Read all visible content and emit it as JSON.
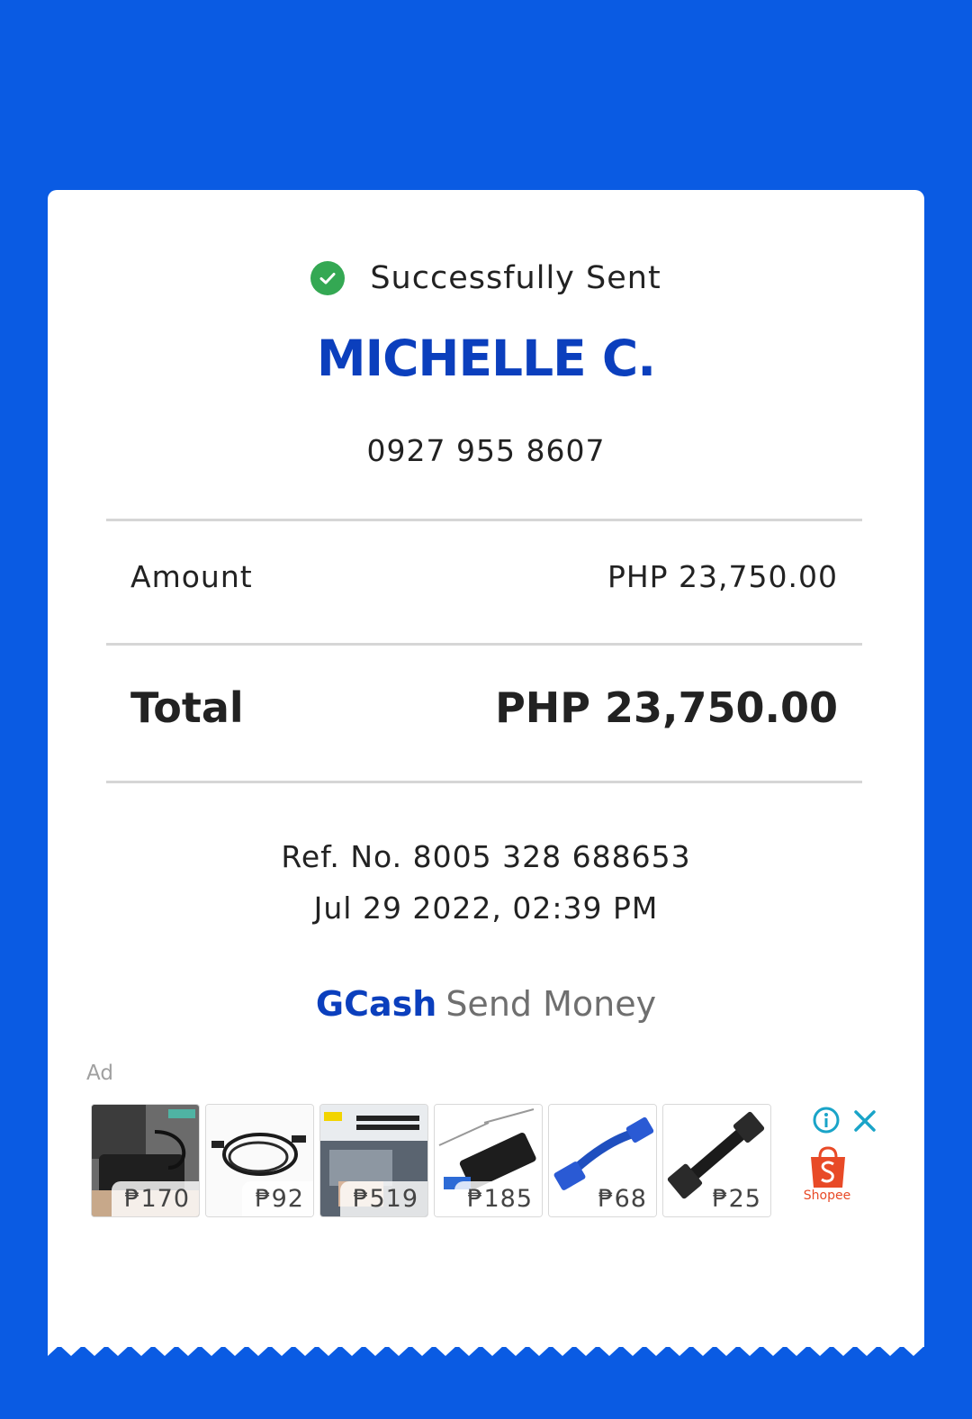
{
  "receipt": {
    "status_text": "Successfully Sent",
    "recipient_name": "MICHELLE C.",
    "recipient_phone": "0927 955 8607",
    "amount_label": "Amount",
    "amount_value": "PHP 23,750.00",
    "total_label": "Total",
    "total_value": "PHP 23,750.00",
    "reference": "Ref. No. 8005 328 688653",
    "datetime": "Jul 29 2022, 02:39 PM",
    "brand_name": "GCash",
    "brand_service": "Send Money"
  },
  "ad": {
    "label": "Ad",
    "products": [
      {
        "price": "₱170",
        "icon": "external-hdd-enclosure"
      },
      {
        "price": "₱92",
        "icon": "usb-cable"
      },
      {
        "price": "₱519",
        "icon": "usb-hub-laptop"
      },
      {
        "price": "₱185",
        "icon": "usb-3-hub"
      },
      {
        "price": "₱68",
        "icon": "usb-extension-cable"
      },
      {
        "price": "₱25",
        "icon": "sata-cable"
      }
    ],
    "advertiser": "Shopee"
  },
  "colors": {
    "background": "#0a5be3",
    "brand_blue": "#0b3fbd",
    "success_green": "#34a853",
    "shopee_orange": "#e84a27",
    "ad_control_cyan": "#1aa4c8"
  }
}
